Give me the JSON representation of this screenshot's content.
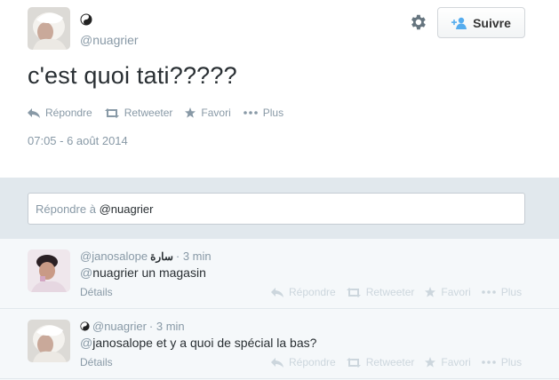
{
  "tweet": {
    "handle": "@nuagrier",
    "text": "c'est quoi tati?????",
    "timestamp": "07:05 - 6 août 2014",
    "follow_label": "Suivre",
    "actions": {
      "reply": "Répondre",
      "retweet": "Retweeter",
      "favorite": "Favori",
      "more": "Plus"
    }
  },
  "reply_box": {
    "prefix": "Répondre à ",
    "mention": "@nuagrier"
  },
  "replies": [
    {
      "handle": "@janosalope",
      "display_name": "سارة",
      "time": "· 3 min",
      "at": "@",
      "mention": "nuagrier",
      "text": " un magasin",
      "details": "Détails",
      "actions": {
        "reply": "Répondre",
        "retweet": "Retweeter",
        "favorite": "Favori",
        "more": "Plus"
      }
    },
    {
      "handle": "@nuagrier",
      "display_name": "",
      "time": "· 3 min",
      "at": "@",
      "mention": "janosalope",
      "text": " et y a quoi de spécial la bas?",
      "details": "Détails",
      "actions": {
        "reply": "Répondre",
        "retweet": "Retweeter",
        "favorite": "Favori",
        "more": "Plus"
      }
    }
  ],
  "colors": {
    "text": "#292f33",
    "muted": "#8899a6",
    "faint": "#ccd6dd",
    "reply_bg": "#e1e8ed",
    "replies_bg": "#f5f8fa",
    "follow_icon": "#55acee"
  }
}
